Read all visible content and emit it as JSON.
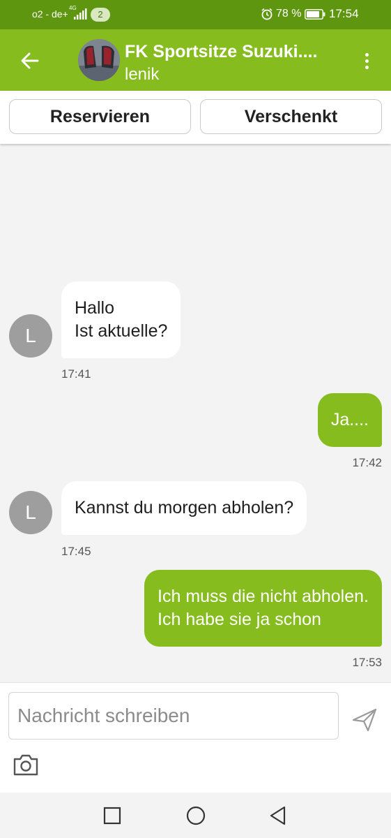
{
  "status_bar": {
    "carrier": "o2 - de+",
    "network": "4G",
    "notification_count": "2",
    "battery": "78 %",
    "time": "17:54",
    "icons": [
      "signal-icon",
      "alarm-icon",
      "battery-icon"
    ]
  },
  "header": {
    "title": "FK Sportsitze Suzuki....",
    "subtitle": "lenik",
    "icons": [
      "back-arrow-icon",
      "more-vert-icon"
    ]
  },
  "actions": {
    "reserve_label": "Reservieren",
    "gift_label": "Verschenkt"
  },
  "messages": [
    {
      "direction": "in",
      "avatar": "L",
      "lines": [
        "Hallo",
        "Ist aktuelle?"
      ],
      "time": "17:41"
    },
    {
      "direction": "out",
      "lines": [
        "Ja...."
      ],
      "time": "17:42"
    },
    {
      "direction": "in",
      "avatar": "L",
      "lines": [
        "Kannst du morgen abholen?"
      ],
      "time": "17:45"
    },
    {
      "direction": "out",
      "lines": [
        "Ich muss die nicht abholen.",
        "Ich habe sie ja schon"
      ],
      "time": "17:53"
    }
  ],
  "composer": {
    "placeholder": "Nachricht schreiben",
    "icons": [
      "send-icon",
      "camera-icon"
    ]
  },
  "nav_bar": {
    "icons": [
      "recents-icon",
      "home-icon",
      "back-icon"
    ]
  },
  "colors": {
    "status_bar": "#5f960f",
    "header": "#86bc1e",
    "outgoing_bubble": "#86bc1e",
    "incoming_bubble": "#ffffff",
    "avatar": "#9e9e9e",
    "chat_background": "#f3f3f3"
  }
}
